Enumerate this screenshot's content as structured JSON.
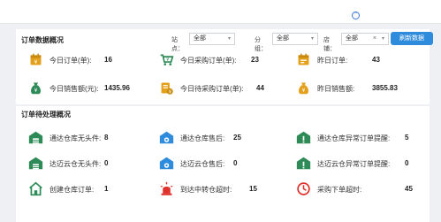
{
  "colors": {
    "accent": "#2f8bdc",
    "green": "#2e8b57",
    "gold": "#e3a01b",
    "red": "#e0312b",
    "blue": "#2f8bdc"
  },
  "topbar": {
    "collapse_icon": "chevron-up-icon",
    "collapse_glyph": "⌃"
  },
  "overview": {
    "title": "订单数据概况",
    "filters": {
      "site_label": "站点：",
      "site_value": "全部",
      "group_label": "分组：",
      "group_value": "全部",
      "store_label": "店铺：",
      "store_value": "全部",
      "store_clear": "×",
      "caret": "▾"
    },
    "refresh_label": "刷新数据",
    "stats": [
      {
        "icon": "calendar-order-icon",
        "label": "今日订单(单):",
        "value": "16"
      },
      {
        "icon": "cart-purchase-icon",
        "label": "今日采购订单(单):",
        "value": "23"
      },
      {
        "icon": "calendar-yesterday-icon",
        "label": "昨日订单:",
        "value": "43"
      },
      {
        "icon": "money-bag-icon",
        "label": "今日销售额(元):",
        "value": "1435.96"
      },
      {
        "icon": "pending-purchase-icon",
        "label": "今日待采购订单(单):",
        "value": "44"
      },
      {
        "icon": "yesterday-sales-icon",
        "label": "昨日销售额:",
        "value": "3855.83"
      }
    ]
  },
  "pending": {
    "title": "订单待处理概况",
    "stats": [
      {
        "icon": "warehouse-icon",
        "label": "通达仓库无头件:",
        "value": "8"
      },
      {
        "icon": "warehouse-aftersale-icon",
        "label": "通达仓库售后:",
        "value": "25"
      },
      {
        "icon": "warehouse-alert-icon",
        "label": "通达仓库异常订单提醒:",
        "value": "5"
      },
      {
        "icon": "warehouse-icon",
        "label": "达迈云仓无头件:",
        "value": "0"
      },
      {
        "icon": "warehouse-aftersale-icon",
        "label": "达迈云仓售后:",
        "value": "0"
      },
      {
        "icon": "warehouse-alert-icon",
        "label": "达迈云仓异常订单提醒:",
        "value": "0"
      },
      {
        "icon": "home-order-icon",
        "label": "创建仓库订单:",
        "value": "1"
      },
      {
        "icon": "alarm-light-icon",
        "label": "到达中转仓超时:",
        "value": "15"
      },
      {
        "icon": "clock-timeout-icon",
        "label": "采购下单超时:",
        "value": "45"
      }
    ]
  }
}
